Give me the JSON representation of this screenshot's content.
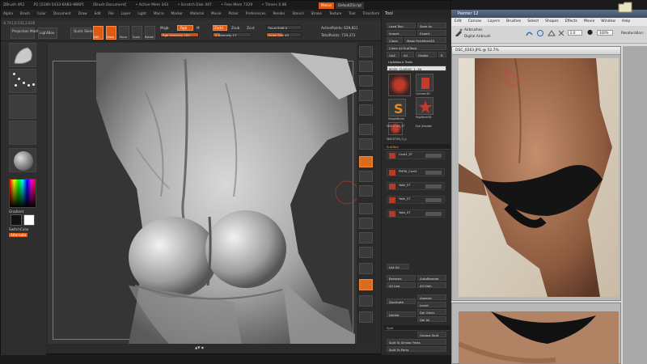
{
  "zbrush": {
    "title_parts": [
      "ZBrush 4R2",
      "P2 [2180-5433-6AB3-9B6P]",
      "[Brush Document]",
      "• Active Mem 343",
      "• Scratch Disk 447",
      "• Free Mem 7329",
      "• Timers 0.86"
    ],
    "menu_label": "Menus",
    "script_label": "DefaultZScript",
    "menu": [
      "Alpha",
      "Brush",
      "Color",
      "Document",
      "Draw",
      "Edit",
      "File",
      "Layer",
      "Light",
      "Macro",
      "Marker",
      "Material",
      "Movie",
      "Picker",
      "Preferences",
      "Render",
      "Stencil",
      "Stroke",
      "Texture",
      "Tool",
      "Transform",
      "Zplugin",
      "Zscript"
    ],
    "toolbar": {
      "projection_master": "Projection Master",
      "lightbox": "LightBox",
      "quick_sketch": "Quick Sketch",
      "edit": "Edit",
      "draw": "Draw",
      "move": "Move",
      "scale": "Scale",
      "rotate": "Rotate",
      "mrgb": "Mrgb",
      "rgb": "Rgb",
      "m": "M",
      "zadd": "Zadd",
      "zsub": "Zsub",
      "zcut": "Zcut",
      "rgb_intensity": "Rgb Intensity 100",
      "z_intensity": "Z Intensity 17",
      "focal_shift": "Focal Shift 0",
      "draw_size": "Draw Size 45",
      "active_points": "ActivePoints: 629,821",
      "total_points": "TotalPoints: 719,373",
      "coords": "-0.741,0.531,2.616",
      "rgb_intensity_value": 1.0,
      "z_intensity_value": 0.17,
      "focal_shift_value": 0.0,
      "draw_size_value": 0.45
    },
    "left": {
      "gradient": "Gradient",
      "switch_color": "SwitchColor",
      "alternate": "Alternate"
    },
    "canvas_footer": "▲▼ ◆"
  },
  "tool_palette": {
    "header": "Tool",
    "load_tool": "Load Tool",
    "save_as": "Save As",
    "import": "Import",
    "export": "Export",
    "clone": "Clone",
    "make_polymesh": "Make PolyMesh3D",
    "clone_all_subtools": "Clone All SubTools",
    "goz": "GoZ",
    "all": "All",
    "visible": "Visible",
    "r": "R",
    "lightbox_tools": "Lightbox ▸ Tools",
    "current_tool": "BODY_CLASSIC_1. 46",
    "tiles": [
      "Cylinder3D",
      "PolyMesh3D",
      "SimpleBrush",
      "SKELETON_ST",
      "Eye_Intpolat",
      "SKELETON_O_p"
    ],
    "subtool_header": "SubTool",
    "subtools": [
      "Cord1_ST",
      "PM3D_Cord1",
      "Yakk_ST",
      "Yakk_ST",
      "Yakk_ST"
    ],
    "list_all": "List All",
    "rename": "Rename",
    "autoreorder": "AutoReorder",
    "all_low": "All Low",
    "all_high": "All High",
    "duplicate": "Duplicate",
    "append": "Append",
    "insert": "Insert",
    "delete": "Delete",
    "del_other": "Del Other",
    "del_all": "Del All",
    "split": "Split",
    "groups_split": "Groups Split",
    "split_unmasked": "Split To Similar Parts",
    "split_to_parts": "Split To Parts"
  },
  "painter": {
    "title": "Painter 12",
    "menu": [
      "Edit",
      "Canvas",
      "Layers",
      "Brushes",
      "Select",
      "Shapes",
      "Effects",
      "Movie",
      "Window",
      "Help"
    ],
    "brush_category": "Airbrushes",
    "brush_variant": "Digital Airbrush",
    "size_value": "2.0",
    "opacity_value": "100%",
    "resaturation": "Resaturation:",
    "doc_title": "DSC_0263.JPG @ 52.7%"
  },
  "colors": {
    "accent": "#e05a14",
    "zbrush_bg": "#2b2b2b",
    "painter_bg": "#d9d9d9"
  }
}
